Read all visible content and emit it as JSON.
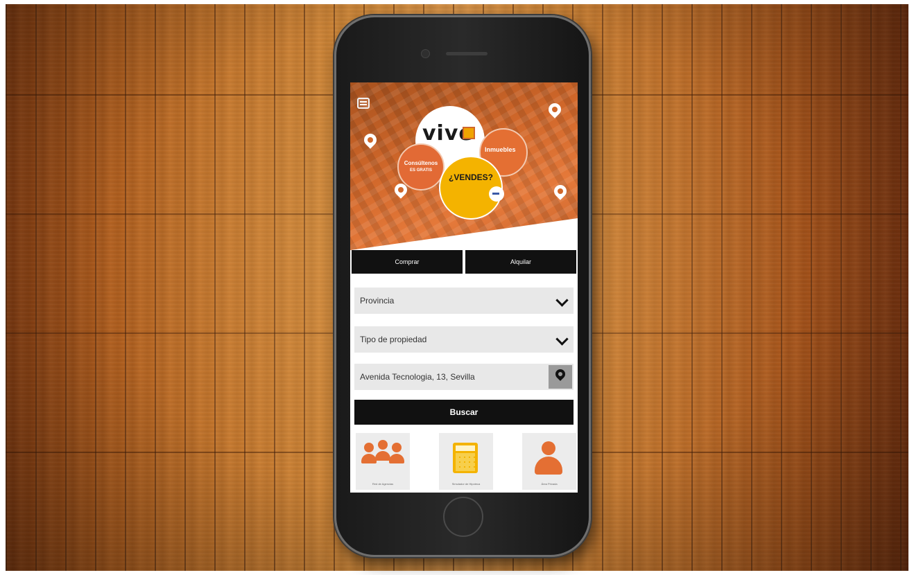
{
  "app": {
    "hero": {
      "logo_text": "vive",
      "bubble_inmuebles": "Inmuebles",
      "bubble_consultanos": "Consúltenos",
      "bubble_consultanos_sub": "ES GRATIS",
      "bubble_vendes": "¿VENDES?"
    },
    "tabs": [
      {
        "label": "Comprar"
      },
      {
        "label": "Alquilar"
      }
    ],
    "form": {
      "provincia": "Provincia",
      "tipo": "Tipo de propiedad",
      "direccion": "Avenida Tecnologia, 13, Sevilla",
      "buscar": "Buscar"
    },
    "bottom": [
      {
        "icon": "people-group-icon",
        "caption": "Red de Agencias"
      },
      {
        "icon": "calculator-icon",
        "caption": "Simulador de Hipoteca"
      },
      {
        "icon": "user-icon",
        "caption": "Área Privada"
      }
    ],
    "colors": {
      "brand_orange": "#e46f33",
      "brand_yellow": "#f4b300",
      "button_black": "#111111"
    }
  }
}
